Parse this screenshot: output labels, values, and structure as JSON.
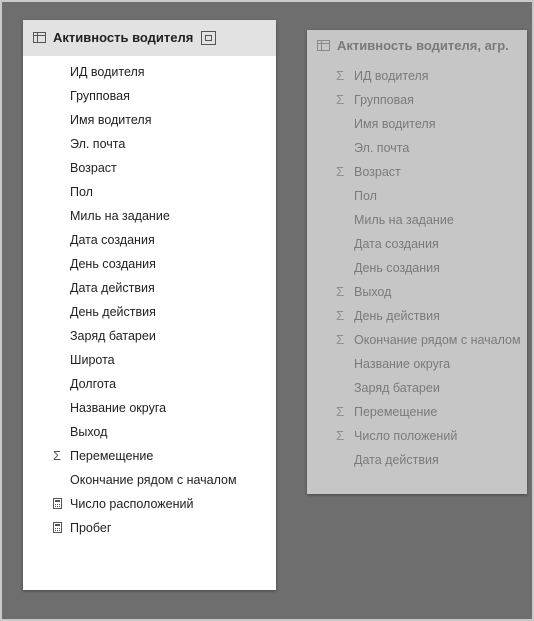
{
  "tables": [
    {
      "title": "Активность водителя",
      "fields": [
        {
          "label": "ИД водителя",
          "icon": ""
        },
        {
          "label": "Групповая",
          "icon": ""
        },
        {
          "label": "Имя водителя",
          "icon": ""
        },
        {
          "label": "Эл. почта",
          "icon": ""
        },
        {
          "label": "Возраст",
          "icon": ""
        },
        {
          "label": "Пол",
          "icon": ""
        },
        {
          "label": "Миль на задание",
          "icon": ""
        },
        {
          "label": "Дата создания",
          "icon": ""
        },
        {
          "label": "День создания",
          "icon": ""
        },
        {
          "label": "Дата действия",
          "icon": ""
        },
        {
          "label": "День действия",
          "icon": ""
        },
        {
          "label": "Заряд батареи",
          "icon": ""
        },
        {
          "label": "Широта",
          "icon": ""
        },
        {
          "label": "Долгота",
          "icon": ""
        },
        {
          "label": "Название округа",
          "icon": ""
        },
        {
          "label": "Выход",
          "icon": ""
        },
        {
          "label": "Перемещение",
          "icon": "sigma"
        },
        {
          "label": "Окончание рядом с началом",
          "icon": ""
        },
        {
          "label": "Число расположений",
          "icon": "calculator"
        },
        {
          "label": "Пробег",
          "icon": "calculator"
        }
      ]
    },
    {
      "title": "Активность водителя, агр.",
      "fields": [
        {
          "label": "ИД водителя",
          "icon": "sigma"
        },
        {
          "label": "Групповая",
          "icon": "sigma"
        },
        {
          "label": "Имя водителя",
          "icon": ""
        },
        {
          "label": "Эл. почта",
          "icon": ""
        },
        {
          "label": "Возраст",
          "icon": "sigma"
        },
        {
          "label": "Пол",
          "icon": ""
        },
        {
          "label": "Миль на задание",
          "icon": ""
        },
        {
          "label": "Дата создания",
          "icon": ""
        },
        {
          "label": "День создания",
          "icon": ""
        },
        {
          "label": "Выход",
          "icon": "sigma"
        },
        {
          "label": "День действия",
          "icon": "sigma"
        },
        {
          "label": "Окончание рядом с началом",
          "icon": "sigma"
        },
        {
          "label": "Название округа",
          "icon": ""
        },
        {
          "label": "Заряд батареи",
          "icon": ""
        },
        {
          "label": "Перемещение",
          "icon": "sigma"
        },
        {
          "label": "Число положений",
          "icon": "sigma"
        },
        {
          "label": "Дата действия",
          "icon": ""
        }
      ]
    }
  ]
}
